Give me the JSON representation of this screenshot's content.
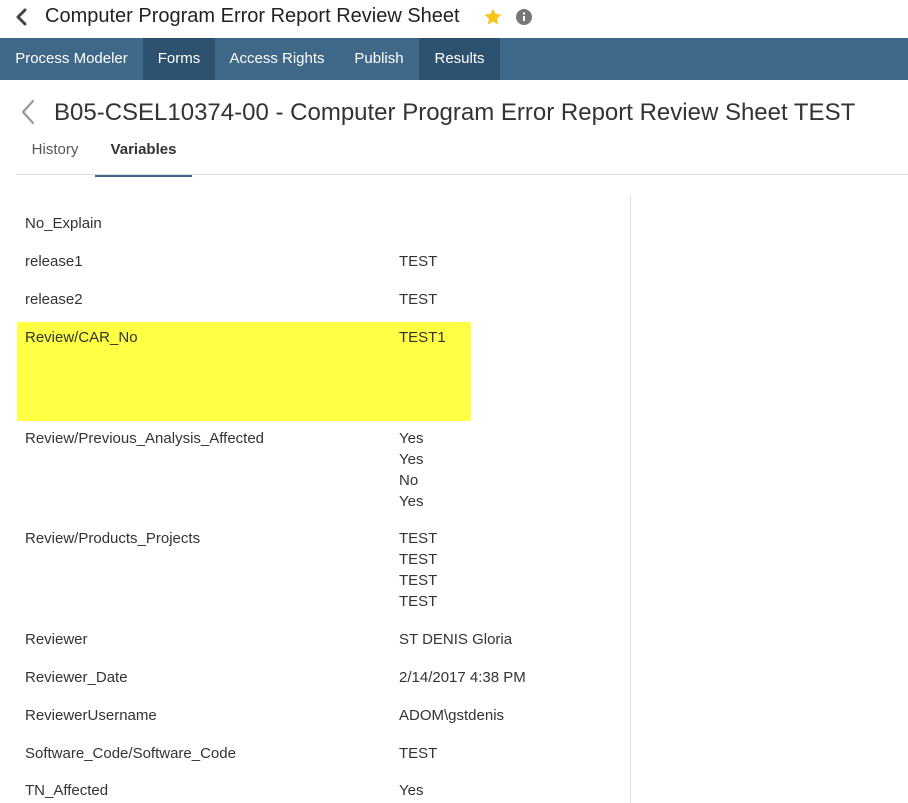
{
  "window": {
    "title": "Computer Program Error Report Review Sheet"
  },
  "nav": {
    "items": [
      {
        "label": "Process Modeler"
      },
      {
        "label": "Forms"
      },
      {
        "label": "Access Rights"
      },
      {
        "label": "Publish"
      },
      {
        "label": "Results"
      }
    ]
  },
  "page": {
    "title": "B05-CSEL10374-00 - Computer Program Error Report Review Sheet TEST",
    "tabs": [
      {
        "label": "History"
      },
      {
        "label": "Variables"
      }
    ]
  },
  "variables": [
    {
      "name": "No_Explain",
      "values": []
    },
    {
      "name": "release1",
      "values": [
        "TEST"
      ]
    },
    {
      "name": "release2",
      "values": [
        "TEST"
      ]
    },
    {
      "name": "Review/CAR_No",
      "values": [
        "TEST1"
      ]
    },
    {
      "name": "Review/Previous_Analysis_Affected",
      "values": [
        "Yes",
        "Yes",
        "No",
        "Yes"
      ]
    },
    {
      "name": "Review/Products_Projects",
      "values": [
        "TEST",
        "TEST",
        "TEST",
        "TEST"
      ]
    },
    {
      "name": "Reviewer",
      "values": [
        "ST DENIS Gloria"
      ]
    },
    {
      "name": "Reviewer_Date",
      "values": [
        "2/14/2017 4:38 PM"
      ]
    },
    {
      "name": "ReviewerUsername",
      "values": [
        "ADOM\\gstdenis"
      ]
    },
    {
      "name": "Software_Code/Software_Code",
      "values": [
        "TEST"
      ]
    },
    {
      "name": "TN_Affected",
      "values": [
        "Yes"
      ]
    }
  ],
  "colors": {
    "nav_bg": "#3f6889",
    "nav_active_bg": "#2c5270",
    "highlight": "#ffff44",
    "star": "#f5c518"
  }
}
